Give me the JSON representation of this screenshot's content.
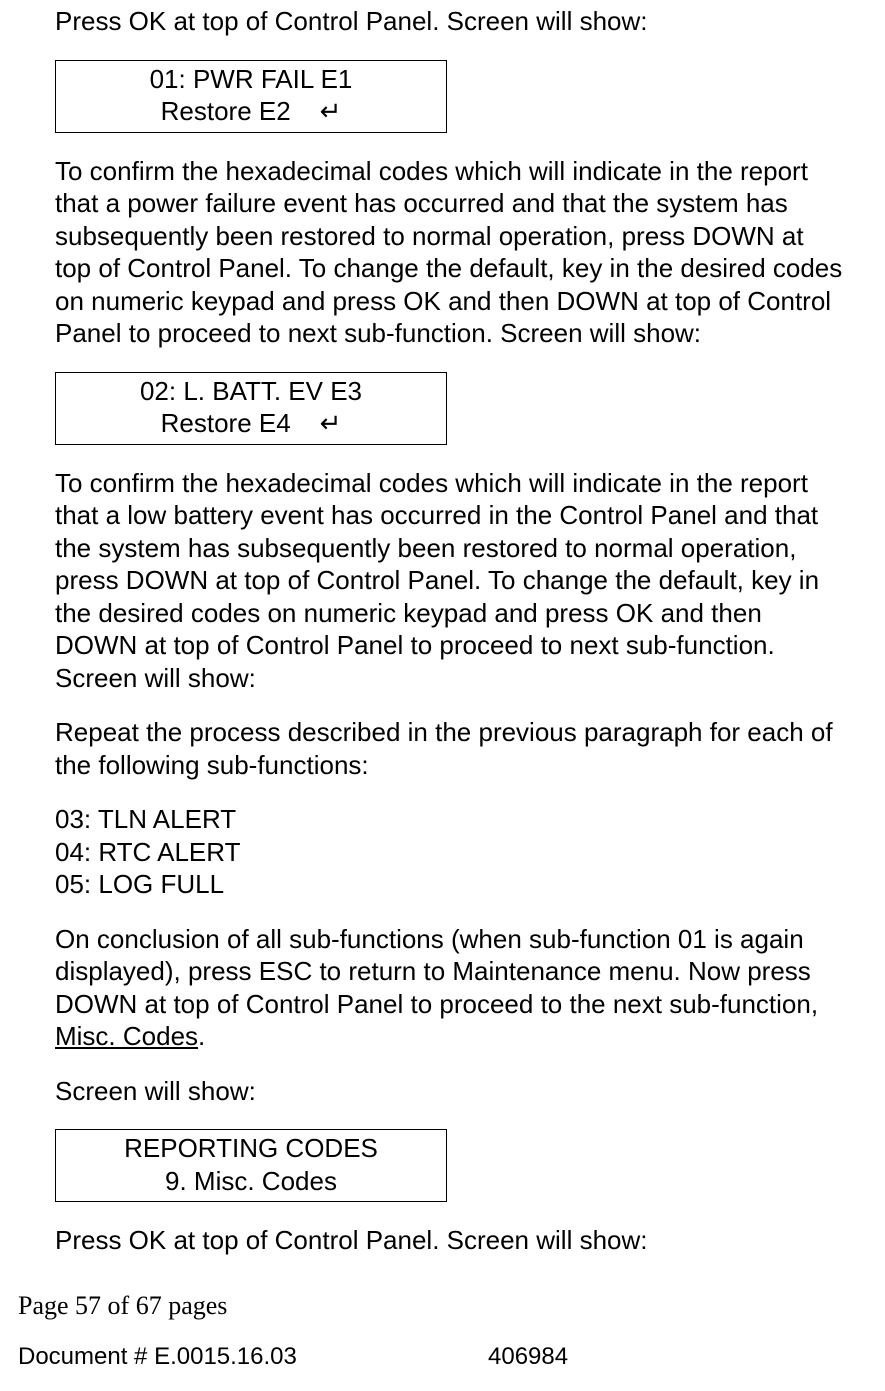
{
  "intro": "Press OK at top of Control Panel. Screen will show:",
  "lcd1": {
    "line1": "01: PWR FAIL E1",
    "line2": "Restore E2    ↵"
  },
  "para1": "To confirm the hexadecimal codes which will indicate in the report that a power failure event has occurred and that the system has subsequently been restored to normal operation, press DOWN at top of Control Panel. To change the default, key in the desired codes on numeric keypad and press OK and then DOWN at top of Control Panel to proceed to next sub-function. Screen will show:",
  "lcd2": {
    "line1": "02: L. BATT. EV E3",
    "line2": "Restore E4    ↵"
  },
  "para2": "To confirm the hexadecimal codes which will indicate in the report that a low battery event has occurred in the Control Panel and that the system has subsequently been restored to normal operation, press DOWN at top of Control Panel. To change the default, key in the desired codes on numeric keypad and press OK and then DOWN at top of Control Panel to proceed to next sub-function. Screen will show:",
  "para3": "Repeat the process described in the previous paragraph for each of the following sub-functions:",
  "subfns": {
    "l1": "03: TLN ALERT",
    "l2": "04: RTC ALERT",
    "l3": "05: LOG FULL"
  },
  "para4a": "On conclusion of all sub-functions (when sub-function 01 is again displayed), press ESC to return to Maintenance menu. Now press DOWN at top of Control Panel to proceed to the next sub-function, ",
  "para4b_underline": "Misc. Codes",
  "para4c": ".",
  "para5": "Screen will show:",
  "lcd3": {
    "line1": "REPORTING CODES",
    "line2": "9. Misc. Codes"
  },
  "para6": "Press OK at top of Control Panel. Screen will show:",
  "footer": {
    "page_line": "Page 57 of  67 pages",
    "doc_id": "Document # E.0015.16.03",
    "doc_num": "406984"
  }
}
